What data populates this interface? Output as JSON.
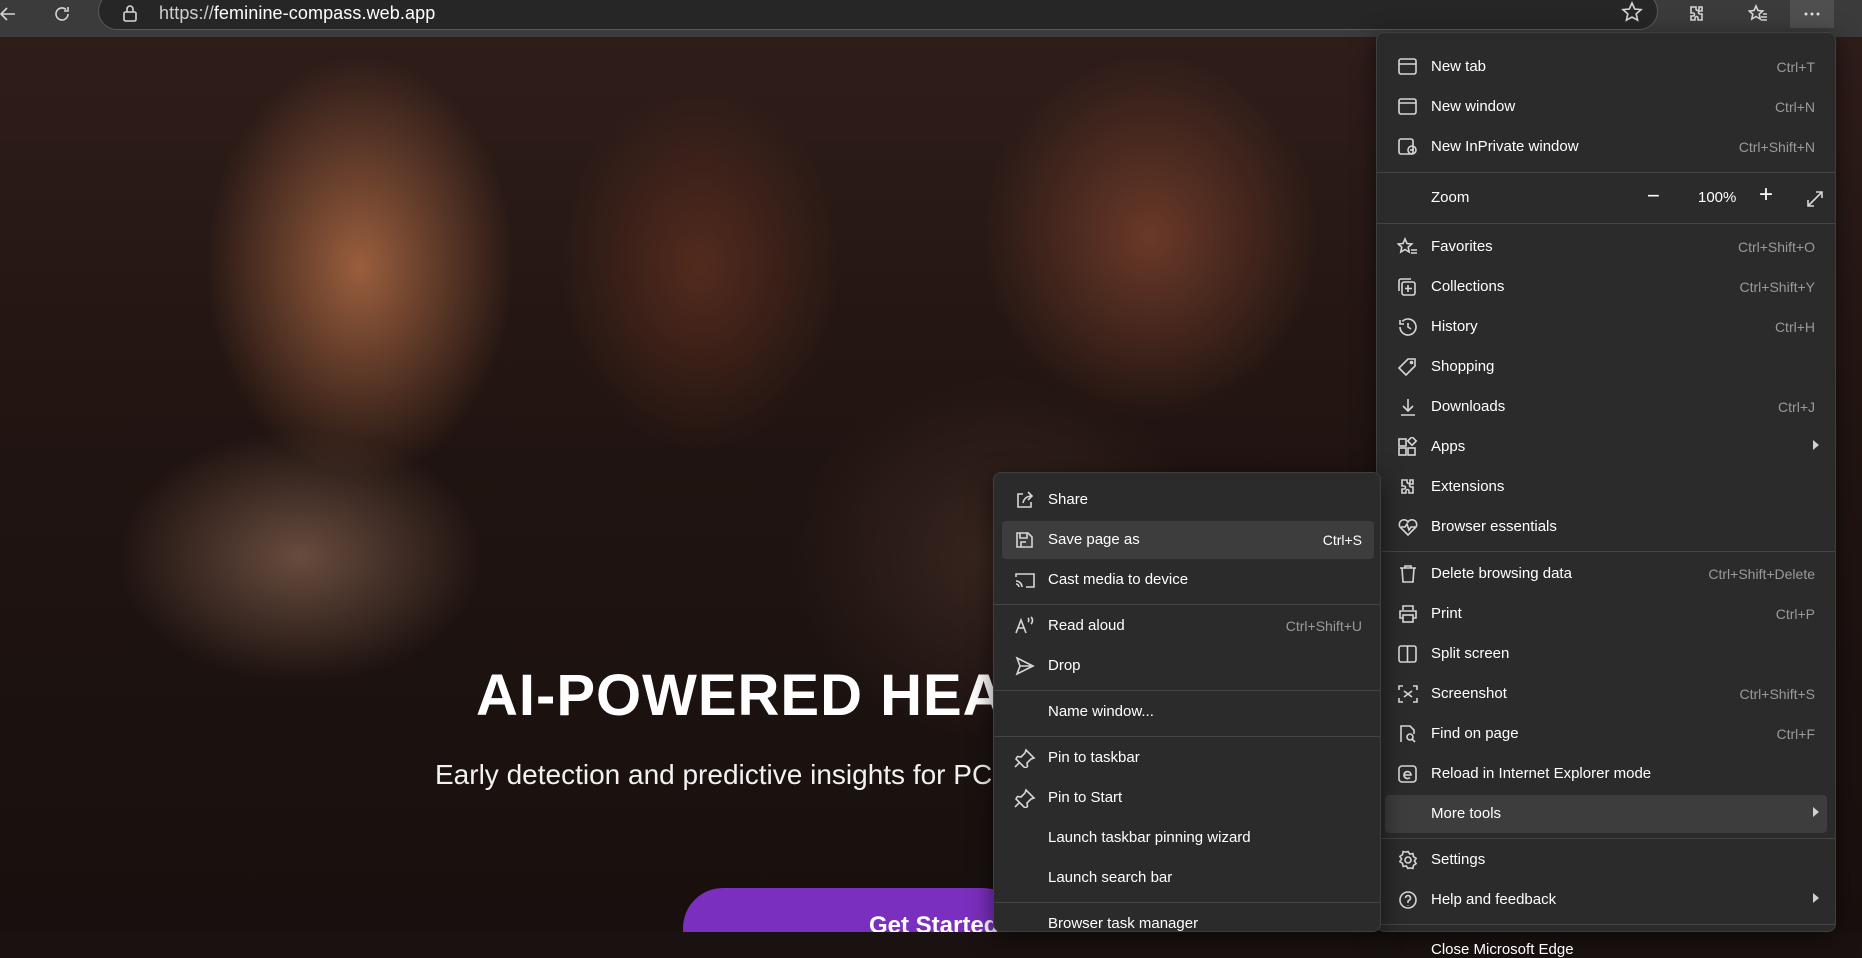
{
  "browser": {
    "url_prefix": "https://",
    "url_host": "feminine-compass.web.app",
    "icons": [
      "back-icon",
      "refresh-icon",
      "lock-icon",
      "star-icon",
      "extensions-icon",
      "favorites-icon",
      "more-icon"
    ]
  },
  "hero": {
    "title": "AI-POWERED HEA",
    "subtitle": "Early detection and predictive insights for PCO",
    "cta_label": "Get Started"
  },
  "main_menu": {
    "items": [
      {
        "label": "New tab",
        "shortcut": "Ctrl+T",
        "icon": "new-tab-icon"
      },
      {
        "label": "New window",
        "shortcut": "Ctrl+N",
        "icon": "new-window-icon"
      },
      {
        "label": "New InPrivate window",
        "shortcut": "Ctrl+Shift+N",
        "icon": "inprivate-icon"
      },
      {
        "label": "Zoom",
        "shortcut": "",
        "icon": ""
      },
      {
        "label": "Favorites",
        "shortcut": "Ctrl+Shift+O",
        "icon": "favorites-icon"
      },
      {
        "label": "Collections",
        "shortcut": "Ctrl+Shift+Y",
        "icon": "collections-icon"
      },
      {
        "label": "History",
        "shortcut": "Ctrl+H",
        "icon": "history-icon"
      },
      {
        "label": "Shopping",
        "shortcut": "",
        "icon": "shopping-tag-icon"
      },
      {
        "label": "Downloads",
        "shortcut": "Ctrl+J",
        "icon": "download-icon"
      },
      {
        "label": "Apps",
        "shortcut": "",
        "icon": "apps-icon"
      },
      {
        "label": "Extensions",
        "shortcut": "",
        "icon": "extensions-icon"
      },
      {
        "label": "Browser essentials",
        "shortcut": "",
        "icon": "heart-pulse-icon"
      },
      {
        "label": "Delete browsing data",
        "shortcut": "Ctrl+Shift+Delete",
        "icon": "trash-icon"
      },
      {
        "label": "Print",
        "shortcut": "Ctrl+P",
        "icon": "print-icon"
      },
      {
        "label": "Split screen",
        "shortcut": "",
        "icon": "split-screen-icon"
      },
      {
        "label": "Screenshot",
        "shortcut": "Ctrl+Shift+S",
        "icon": "screenshot-icon"
      },
      {
        "label": "Find on page",
        "shortcut": "Ctrl+F",
        "icon": "find-icon"
      },
      {
        "label": "Reload in Internet Explorer mode",
        "shortcut": "",
        "icon": "ie-icon"
      },
      {
        "label": "More tools",
        "shortcut": "",
        "icon": ""
      },
      {
        "label": "Settings",
        "shortcut": "",
        "icon": "settings-icon"
      },
      {
        "label": "Help and feedback",
        "shortcut": "",
        "icon": "help-icon"
      },
      {
        "label": "Close Microsoft Edge",
        "shortcut": "",
        "icon": ""
      }
    ],
    "zoom_value": "100%"
  },
  "sub_menu": {
    "items": [
      {
        "label": "Share",
        "shortcut": "",
        "icon": "share-icon"
      },
      {
        "label": "Save page as",
        "shortcut": "Ctrl+S",
        "icon": "save-icon"
      },
      {
        "label": "Cast media to device",
        "shortcut": "",
        "icon": "cast-icon"
      },
      {
        "label": "Read aloud",
        "shortcut": "Ctrl+Shift+U",
        "icon": "read-aloud-icon"
      },
      {
        "label": "Drop",
        "shortcut": "",
        "icon": "send-icon"
      },
      {
        "label": "Name window...",
        "shortcut": "",
        "icon": ""
      },
      {
        "label": "Pin to taskbar",
        "shortcut": "",
        "icon": "pin-icon"
      },
      {
        "label": "Pin to Start",
        "shortcut": "",
        "icon": "pin-icon"
      },
      {
        "label": "Launch taskbar pinning wizard",
        "shortcut": "",
        "icon": ""
      },
      {
        "label": "Launch search bar",
        "shortcut": "",
        "icon": ""
      },
      {
        "label": "Browser task manager",
        "shortcut": "",
        "icon": ""
      }
    ]
  },
  "colors": {
    "toolbar": "#3b3b3b",
    "menu_bg": "#2b2b2b",
    "menu_highlight": "#3d3d3d",
    "cta": "#7b2fbe"
  }
}
